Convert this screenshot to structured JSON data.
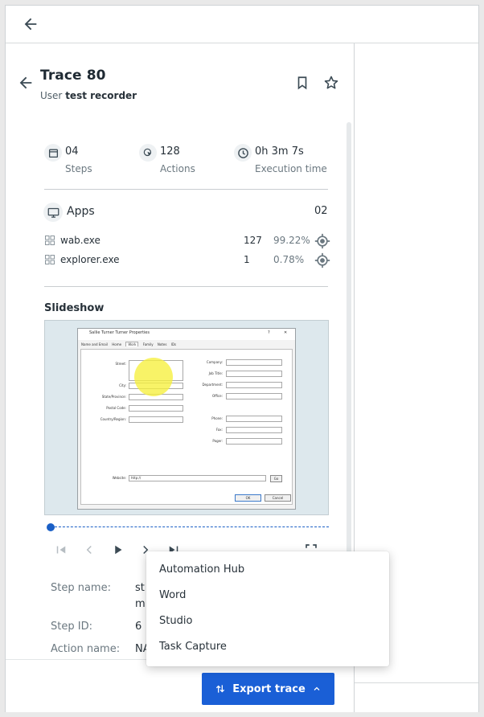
{
  "trace": {
    "title": "Trace 80",
    "user_prefix": "User",
    "user_name": "test recorder"
  },
  "stats": [
    {
      "value": "04",
      "label": "Steps",
      "icon": "calendar-icon"
    },
    {
      "value": "128",
      "label": "Actions",
      "icon": "click-icon"
    },
    {
      "value": "0h 3m 7s",
      "label": "Execution time",
      "icon": "clock-icon"
    }
  ],
  "apps": {
    "label": "Apps",
    "count": "02",
    "items": [
      {
        "name": "wab.exe",
        "count": "127",
        "percent": "99.22%"
      },
      {
        "name": "explorer.exe",
        "count": "1",
        "percent": "0.78%"
      }
    ]
  },
  "slideshow": {
    "label": "Slideshow",
    "screenshot": {
      "title": "Sallie Turner Turner Properties",
      "help": "?",
      "close": "✕",
      "tabs": [
        "Name and Email",
        "Home",
        "Work",
        "Family",
        "Notes",
        "IDs"
      ],
      "left_fields": [
        "Street:",
        "City:",
        "State/Province:",
        "Postal Code:",
        "Country/Region:"
      ],
      "right_fields": [
        "Company:",
        "Job Title:",
        "Department:",
        "Office:",
        "Phone:",
        "Fax:",
        "Pager:"
      ],
      "website_label": "Website:",
      "website_value": "http://",
      "go": "Go",
      "ok": "OK",
      "cancel": "Cancel"
    }
  },
  "details": [
    {
      "label": "Step name:",
      "value": "st"
    },
    {
      "label": "",
      "value": "m"
    },
    {
      "label": "Step ID:",
      "value": "6"
    },
    {
      "label": "Action name:",
      "value": "NA"
    }
  ],
  "export_menu": {
    "items": [
      "Automation Hub",
      "Word",
      "Studio",
      "Task Capture"
    ]
  },
  "export_button": {
    "label": "Export trace"
  },
  "colors": {
    "accent": "#1a5fd6",
    "cursor_highlight": "#f6f03c"
  }
}
